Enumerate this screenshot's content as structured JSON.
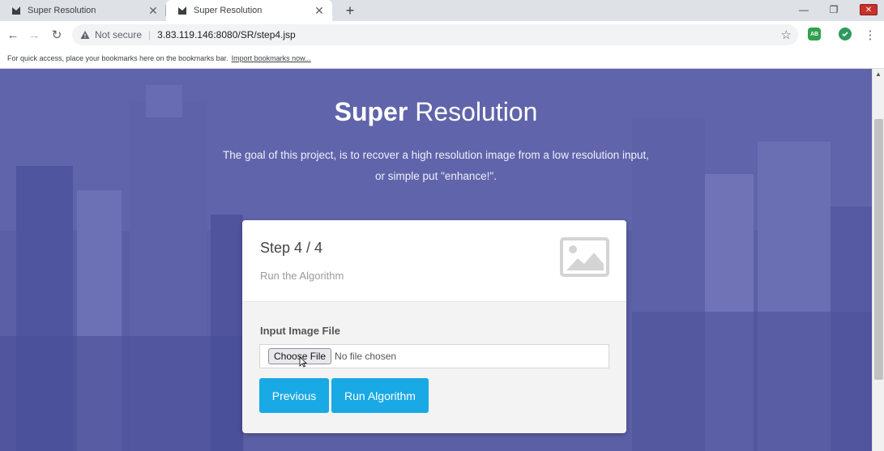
{
  "browser": {
    "tabs": [
      {
        "title": "Super Resolution",
        "active": false
      },
      {
        "title": "Super Resolution",
        "active": true
      }
    ],
    "omnibox": {
      "security": "Not secure",
      "url": "3.83.119.146:8080/SR/step4.jsp"
    },
    "bookmarks_bar": {
      "text": "For quick access, place your bookmarks here on the bookmarks bar.",
      "link": "Import bookmarks now..."
    },
    "extension_label": "AB"
  },
  "hero": {
    "title_bold": "Super",
    "title_light": "Resolution",
    "description_line1": "The goal of this project, is to recover a high resolution image from a low resolution input,",
    "description_line2": "or simple put \"enhance!\"."
  },
  "card": {
    "step_title": "Step 4 / 4",
    "step_subtitle": "Run the Algorithm",
    "input_label": "Input Image File",
    "file_button": "Choose File",
    "file_status": "No file chosen",
    "previous_button": "Previous",
    "run_button": "Run Algorithm"
  },
  "colors": {
    "overlay": "#5a5fa5",
    "button": "#19a9e5"
  }
}
